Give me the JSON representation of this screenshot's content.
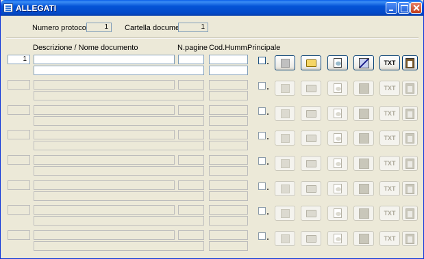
{
  "window": {
    "title": "ALLEGATI"
  },
  "header": {
    "protocol_label": "Numero protocollo:",
    "protocol_value": "1",
    "folder_label": "Cartella documenti:",
    "folder_value": "1"
  },
  "columns": {
    "description": "Descrizione / Nome documento",
    "pages": "N.pagine",
    "code": "Cod.Humm.",
    "principal": "Principale"
  },
  "rows": [
    {
      "index": "1",
      "description": "",
      "note": "",
      "pages": "",
      "code": "",
      "code2": "",
      "principal": false,
      "active": true
    },
    {
      "index": "",
      "description": "",
      "note": "",
      "pages": "",
      "code": "",
      "code2": "",
      "principal": false,
      "active": false
    },
    {
      "index": "",
      "description": "",
      "note": "",
      "pages": "",
      "code": "",
      "code2": "",
      "principal": false,
      "active": false
    },
    {
      "index": "",
      "description": "",
      "note": "",
      "pages": "",
      "code": "",
      "code2": "",
      "principal": false,
      "active": false
    },
    {
      "index": "",
      "description": "",
      "note": "",
      "pages": "",
      "code": "",
      "code2": "",
      "principal": false,
      "active": false
    },
    {
      "index": "",
      "description": "",
      "note": "",
      "pages": "",
      "code": "",
      "code2": "",
      "principal": false,
      "active": false
    },
    {
      "index": "",
      "description": "",
      "note": "",
      "pages": "",
      "code": "",
      "code2": "",
      "principal": false,
      "active": false
    },
    {
      "index": "",
      "description": "",
      "note": "",
      "pages": "",
      "code": "",
      "code2": "",
      "principal": false,
      "active": false
    }
  ],
  "row_buttons": [
    {
      "name": "select-button",
      "icon": "square-icon"
    },
    {
      "name": "open-folder-button",
      "icon": "open-folder-icon"
    },
    {
      "name": "view-document-button",
      "icon": "document-view-icon"
    },
    {
      "name": "edit-button",
      "icon": "pen-icon"
    },
    {
      "name": "text-button",
      "icon": "txt-icon",
      "label": "TXT"
    },
    {
      "name": "paste-button",
      "icon": "clipboard-icon"
    }
  ]
}
